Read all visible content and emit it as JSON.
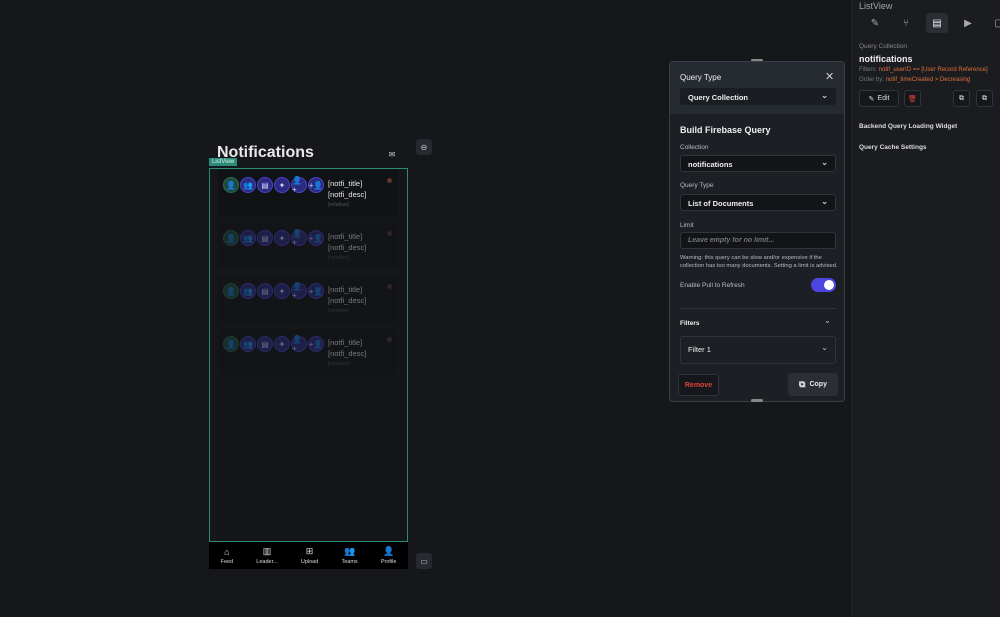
{
  "canvas": {
    "page_title": "Notifications",
    "listview_tag": "ListView",
    "cards": [
      {
        "title": "[notfi_title]",
        "desc": "[notfi_desc]",
        "time": "[relative]"
      },
      {
        "title": "[notfi_title]",
        "desc": "[notfi_desc]",
        "time": "[relative]"
      },
      {
        "title": "[notfi_title]",
        "desc": "[notfi_desc]",
        "time": "[relative]"
      },
      {
        "title": "[notfi_title]",
        "desc": "[notfi_desc]",
        "time": "[relative]"
      }
    ],
    "nav": [
      {
        "icon": "home-icon",
        "glyph": "⌂",
        "label": "Feed"
      },
      {
        "icon": "bar-chart-icon",
        "glyph": "▥",
        "label": "Leader..."
      },
      {
        "icon": "upload-icon",
        "glyph": "⊞",
        "label": "Upload"
      },
      {
        "icon": "teams-icon",
        "glyph": "👥",
        "label": "Teams"
      },
      {
        "icon": "profile-icon",
        "glyph": "👤",
        "label": "Profile"
      }
    ]
  },
  "query_panel": {
    "header": "Query Type",
    "query_type_value": "Query Collection",
    "section_title": "Build Firebase Query",
    "collection_label": "Collection",
    "collection_value": "notifications",
    "query_type_label": "Query Type",
    "query_type2_value": "List of Documents",
    "limit_label": "Limit",
    "limit_placeholder": "Leave empty for no limit...",
    "warning": "Warning: this query can be slow and/or expensive if the collection has too many documents. Setting a limit is advised.",
    "pull_refresh_label": "Enable Pull to Refresh",
    "pull_refresh_on": true,
    "filters_label": "Filters",
    "filter1": "Filter 1",
    "remove": "Remove",
    "copy": "Copy"
  },
  "right_panel": {
    "widget_name": "ListView",
    "query_collection_label": "Query Collection",
    "collection": "notifications",
    "filters_label": "Filters:",
    "filters_value": "notif_userID == [User Record Reference]",
    "order_label": "Order by:",
    "order_value": "notif_timeCreated > Decreasing",
    "edit": "Edit",
    "loading_widget": "Backend Query Loading Widget",
    "cache_settings": "Query Cache Settings"
  },
  "colors": {
    "accent": "#4b46e0",
    "listview": "#2b8a78",
    "danger": "#e0443a",
    "orange": "#e0703a"
  }
}
